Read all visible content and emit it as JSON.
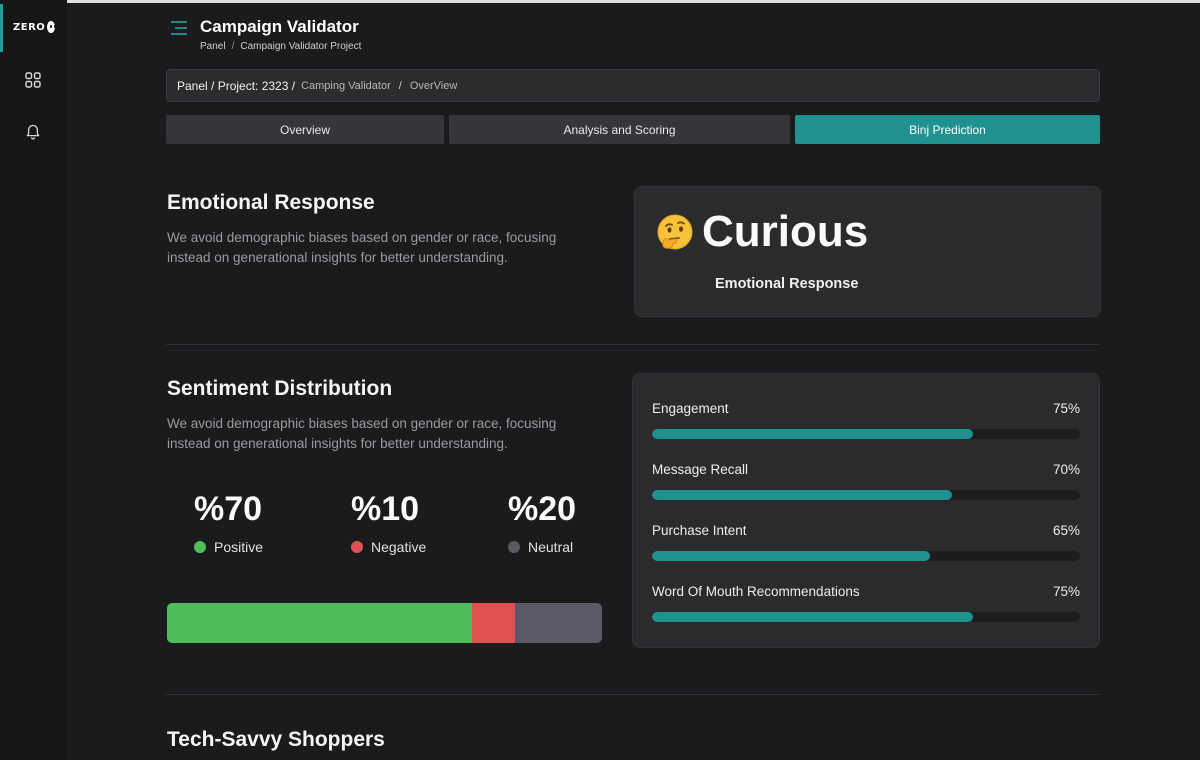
{
  "sidebar": {
    "logo_text": "ZERO",
    "items": [
      {
        "icon": "grid-icon"
      },
      {
        "icon": "bell-icon"
      }
    ]
  },
  "header": {
    "title": "Campaign Validator",
    "breadcrumb": [
      "Panel",
      "Campaign Validator Project"
    ]
  },
  "pathbar": {
    "project": "Panel / Project: 2323 /",
    "segment": "Camping Validator",
    "sep": "/",
    "current": "OverView"
  },
  "tabs": [
    {
      "label": "Overview",
      "active": false
    },
    {
      "label": "Analysis and Scoring",
      "active": false
    },
    {
      "label": "Binj Prediction",
      "active": true
    }
  ],
  "emotional": {
    "title": "Emotional Response",
    "description": "We avoid demographic biases based on gender or race, focusing instead on generational insights for better understanding.",
    "emoji_icon": "thinking-face-icon",
    "word": "Curious",
    "label": "Emotional Response"
  },
  "sentiment": {
    "title": "Sentiment Distribution",
    "description": "We avoid demographic biases based on gender or race, focusing instead on generational insights for better understanding.",
    "stats": [
      {
        "value": "%70",
        "label": "Positive",
        "color": "#4fbe5b",
        "share": 70
      },
      {
        "value": "%10",
        "label": "Negative",
        "color": "#e05252",
        "share": 10
      },
      {
        "value": "%20",
        "label": "Neutral",
        "color": "#5a5a66",
        "share": 20
      }
    ]
  },
  "metrics": [
    {
      "label": "Engagement",
      "value": "75%",
      "fraction": 0.75
    },
    {
      "label": "Message Recall",
      "value": "70%",
      "fraction": 0.7
    },
    {
      "label": "Purchase Intent",
      "value": "65%",
      "fraction": 0.65
    },
    {
      "label": "Word Of Mouth Recommendations",
      "value": "75%",
      "fraction": 0.75
    }
  ],
  "next_section": {
    "title": "Tech-Savvy Shoppers"
  },
  "colors": {
    "accent": "#1f9190",
    "positive": "#4fbe5b",
    "negative": "#e05252",
    "neutral": "#5a5a66"
  }
}
